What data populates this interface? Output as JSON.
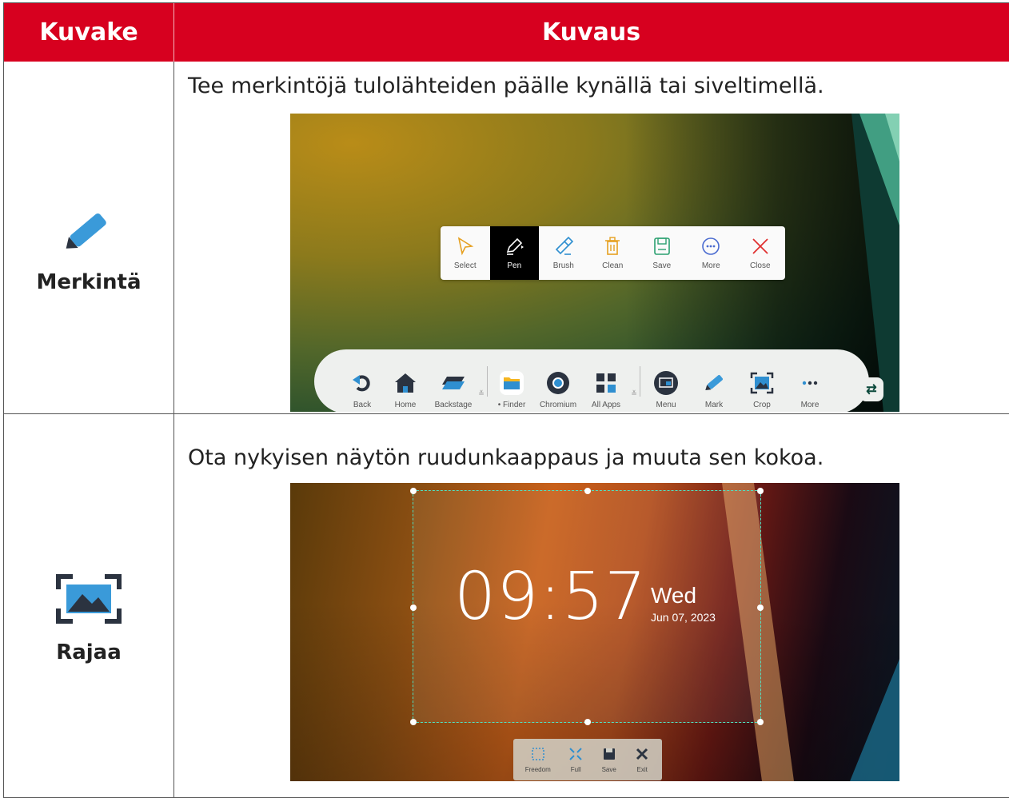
{
  "header": {
    "col_icon": "Kuvake",
    "col_desc": "Kuvaus"
  },
  "rows": [
    {
      "icon_label": "Merkintä",
      "description": "Tee merkintöjä tulolähteiden päälle kynällä tai siveltimellä.",
      "toolbar": [
        {
          "label": "Select",
          "icon": "cursor-icon"
        },
        {
          "label": "Pen",
          "icon": "pen-icon",
          "active": true
        },
        {
          "label": "Brush",
          "icon": "brush-icon"
        },
        {
          "label": "Clean",
          "icon": "trash-icon"
        },
        {
          "label": "Save",
          "icon": "save-icon"
        },
        {
          "label": "More",
          "icon": "more-circle-icon"
        },
        {
          "label": "Close",
          "icon": "close-icon"
        }
      ],
      "dock": {
        "back": "Back",
        "home": "Home",
        "backstage": "Backstage",
        "finder": "• Finder",
        "chromium": "Chromium",
        "all_apps": "All Apps",
        "menu": "Menu",
        "mark": "Mark",
        "crop": "Crop",
        "more": "More"
      }
    },
    {
      "icon_label": "Rajaa",
      "description": "Ota nykyisen näytön ruudunkaappaus ja muuta sen kokoa.",
      "clock": {
        "time": "09:57",
        "day": "Wed",
        "date": "Jun 07, 2023"
      },
      "crop_tools": {
        "freedom": "Freedom",
        "full": "Full",
        "save": "Save",
        "exit": "Exit"
      }
    }
  ],
  "colors": {
    "header_bg": "#d7001f",
    "pen_blue": "#3a9ad9",
    "dark_icon": "#2b3340"
  }
}
